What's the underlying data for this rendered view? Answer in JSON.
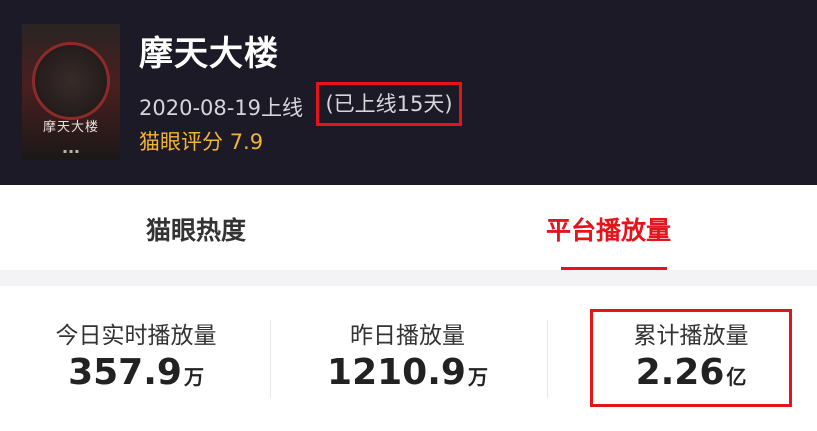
{
  "movie": {
    "title": "摩天大楼",
    "release_text": "2020-08-19上线",
    "online_days": "(已上线15天)",
    "rating_label": "猫眼评分",
    "rating_value": "7.9",
    "poster_title": "摩天大楼"
  },
  "tabs": [
    {
      "label": "猫眼热度",
      "active": false
    },
    {
      "label": "平台播放量",
      "active": true
    }
  ],
  "stats": [
    {
      "label": "今日实时播放量",
      "value": "357.9",
      "unit": "万"
    },
    {
      "label": "昨日播放量",
      "value": "1210.9",
      "unit": "万"
    },
    {
      "label": "累计播放量",
      "value": "2.26",
      "unit": "亿"
    }
  ],
  "colors": {
    "header_bg": "#1c1a27",
    "accent_red": "#e5141b",
    "rating_gold": "#f3b437"
  }
}
